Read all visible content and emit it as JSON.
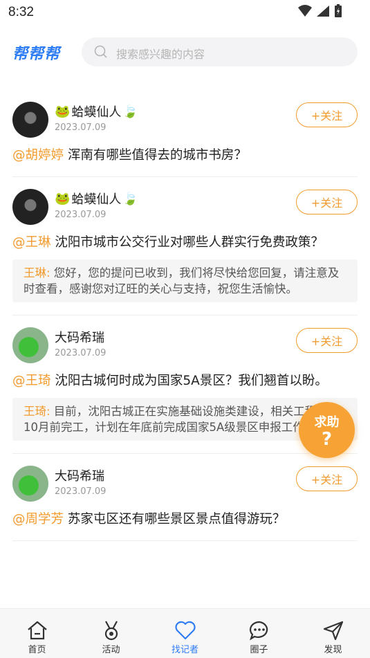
{
  "status_bar": {
    "time": "8:32"
  },
  "header": {
    "logo": "帮帮帮",
    "search_placeholder": "搜索感兴趣的内容"
  },
  "posts": [
    {
      "author": "蛤蟆仙人",
      "date": "2023.07.09",
      "follow_label": "+关注",
      "mention": "@胡婷婷",
      "question": " 浑南有哪些值得去的城市书房？"
    },
    {
      "author": "蛤蟆仙人",
      "date": "2023.07.09",
      "follow_label": "+关注",
      "mention": "@王琳",
      "question": " 沈阳市城市公交行业对哪些人群实行免费政策？",
      "reply_name": "王琳:",
      "reply_text": " 您好，您的提问已收到，我们将尽快给您回复，请注意及时查看，感谢您对辽旺的关心与支持，祝您生活愉快。"
    },
    {
      "author": "大码希瑞",
      "date": "2023.07.09",
      "follow_label": "+关注",
      "mention": "@王琦",
      "question": " 沈阳古城何时成为国家5A景区？我们翘首以盼。",
      "reply_name": "王琦:",
      "reply_text": " 目前，沈阳古城正在实施基础设施类建设，相关工程预计10月前完工，计划在年底前完成国家5A级景区申报工作。"
    },
    {
      "author": "大码希瑞",
      "date": "2023.07.09",
      "follow_label": "+关注",
      "mention": "@周学芳",
      "question": " 苏家屯区还有哪些景区景点值得游玩？"
    }
  ],
  "fab": {
    "label": "求助",
    "glyph": "?"
  },
  "tabs": [
    {
      "label": "首页",
      "icon": "home-icon"
    },
    {
      "label": "活动",
      "icon": "medal-icon"
    },
    {
      "label": "找记者",
      "icon": "heart-icon",
      "active": true
    },
    {
      "label": "圈子",
      "icon": "chat-bubble-icon"
    },
    {
      "label": "发现",
      "icon": "send-icon"
    }
  ],
  "colors": {
    "accent": "#2f7df5",
    "orange": "#f29b2e"
  }
}
